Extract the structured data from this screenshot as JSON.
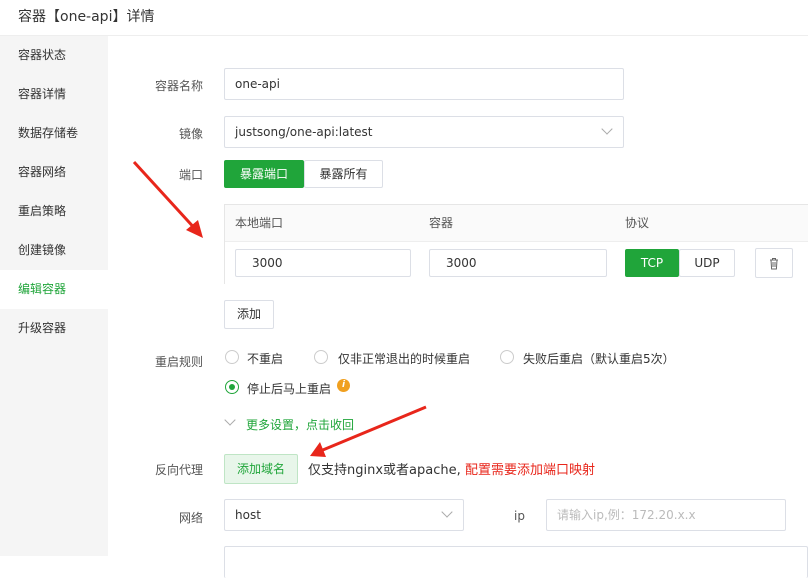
{
  "window": {
    "title": "容器【one-api】详情"
  },
  "sidebar": {
    "items": [
      {
        "label": "容器状态"
      },
      {
        "label": "容器详情"
      },
      {
        "label": "数据存储卷"
      },
      {
        "label": "容器网络"
      },
      {
        "label": "重启策略"
      },
      {
        "label": "创建镜像"
      },
      {
        "label": "编辑容器"
      },
      {
        "label": "升级容器"
      }
    ],
    "active_index": 6
  },
  "form": {
    "name_label": "容器名称",
    "name_value": "one-api",
    "image_label": "镜像",
    "image_value": "justsong/one-api:latest",
    "port_label": "端口",
    "port_tabs": {
      "expose": "暴露端口",
      "expose_all": "暴露所有"
    },
    "port_table": {
      "headers": {
        "local": "本地端口",
        "container": "容器",
        "protocol": "协议"
      },
      "row": {
        "local": "3000",
        "container": "3000",
        "tcp": "TCP",
        "udp": "UDP"
      }
    },
    "add_label": "添加",
    "restart_label": "重启规则",
    "restart_options": [
      "不重启",
      "仅非正常退出的时候重启",
      "失败后重启（默认重启5次）",
      "停止后马上重启"
    ],
    "restart_selected": 3,
    "more_settings": "更多设置，点击收回",
    "proxy_label": "反向代理",
    "add_domain": "添加域名",
    "proxy_note": "仅支持nginx或者apache,",
    "proxy_warning": "配置需要添加端口映射",
    "network_label": "网络",
    "network_value": "host",
    "ip_label": "ip",
    "ip_placeholder": "请输入ip,例：172.20.x.x"
  },
  "colors": {
    "accent": "#20a53a",
    "arrow": "#e8261b",
    "warning": "#e8261b",
    "info": "#f0a020"
  }
}
